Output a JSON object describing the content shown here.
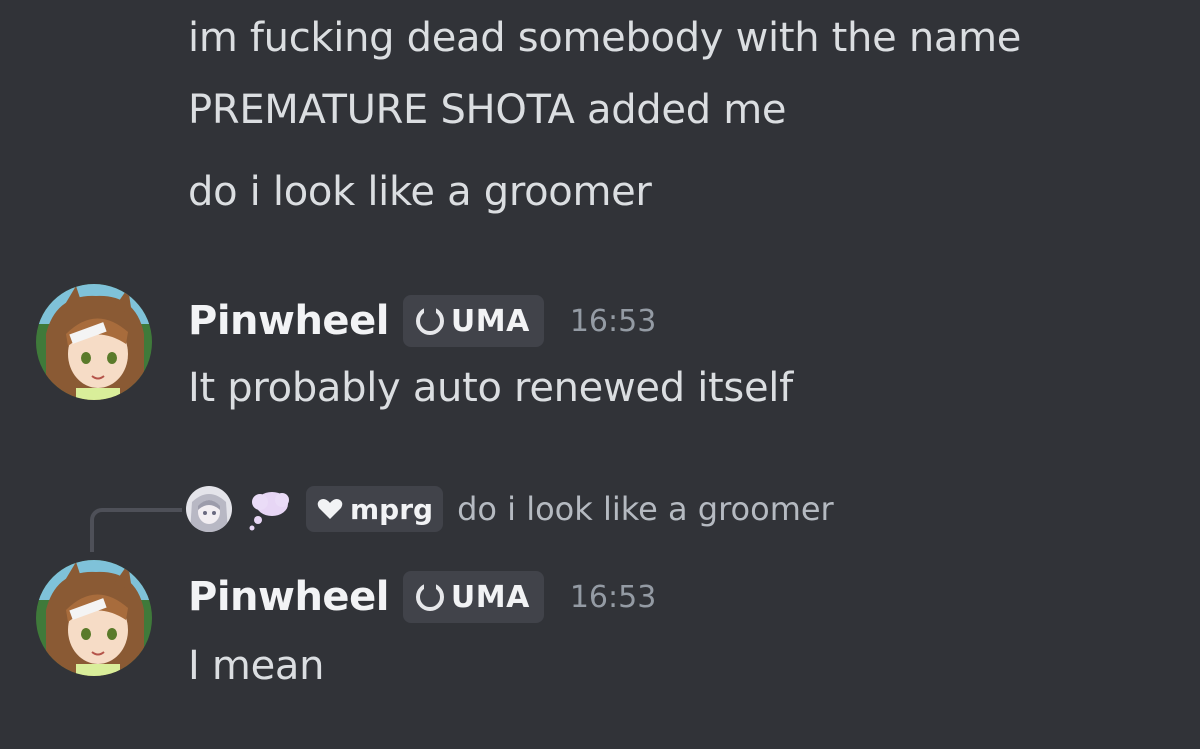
{
  "messages": {
    "first_lines": [
      "im fucking dead somebody with the name",
      "PREMATURE SHOTA added me",
      "do i look like a groomer"
    ],
    "pinwheel_1": {
      "username": "Pinwheel",
      "tag": "UMA",
      "timestamp": "16:53",
      "content": "It probably auto renewed itself",
      "avatar_icon": "horse-girl-avatar"
    },
    "reply": {
      "tag": "mprg",
      "text": "do i look like a groomer",
      "avatar_icon": "silver-hair-avatar",
      "decoration_icon": "thought-bubble-icon",
      "tag_icon": "heart-icon"
    },
    "pinwheel_2": {
      "username": "Pinwheel",
      "tag": "UMA",
      "timestamp": "16:53",
      "content": "I mean",
      "avatar_icon": "horse-girl-avatar"
    }
  },
  "colors": {
    "background": "#313338",
    "text": "#dbdee1",
    "username": "#f2f3f5",
    "timestamp": "#949ba4",
    "tag_background": "#41434a",
    "reply_line": "#4e5058"
  }
}
